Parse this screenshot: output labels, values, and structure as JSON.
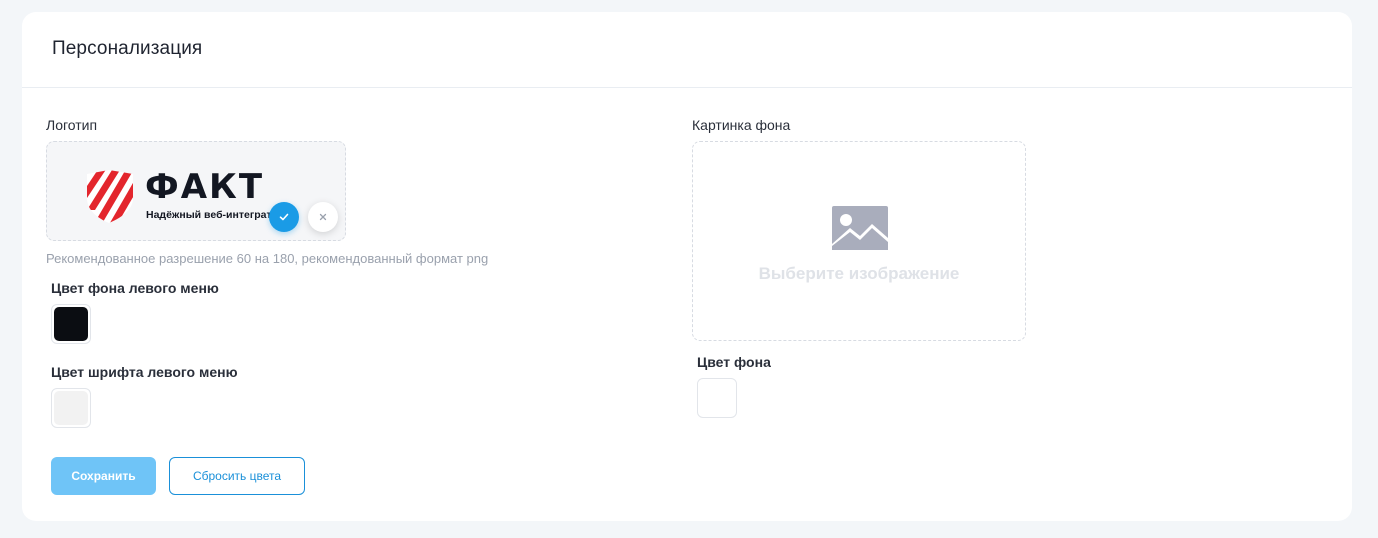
{
  "header": {
    "title": "Персонализация"
  },
  "logo": {
    "label": "Логотип",
    "wordmark": "ФАКТ",
    "tagline": "Надёжный веб-интегратор",
    "confirm_icon": "check-icon",
    "cancel_icon": "close-icon",
    "hint": "Рекомендованное разрешение 60 на 180, рекомендованный формат png"
  },
  "left_menu_bg": {
    "label": "Цвет фона левого меню",
    "color": "#0b0d12"
  },
  "left_menu_font": {
    "label": "Цвет шрифта левого меню",
    "color": "#f2f2f2"
  },
  "background_image": {
    "label": "Картинка фона",
    "placeholder_icon": "image-icon",
    "placeholder_text": "Выберите изображение"
  },
  "background_color": {
    "label": "Цвет фона",
    "color": "#ffffff"
  },
  "actions": {
    "save_label": "Сохранить",
    "reset_label": "Сбросить цвета"
  },
  "colors": {
    "accent": "#1a9be6",
    "logo_red": "#e3262d"
  }
}
